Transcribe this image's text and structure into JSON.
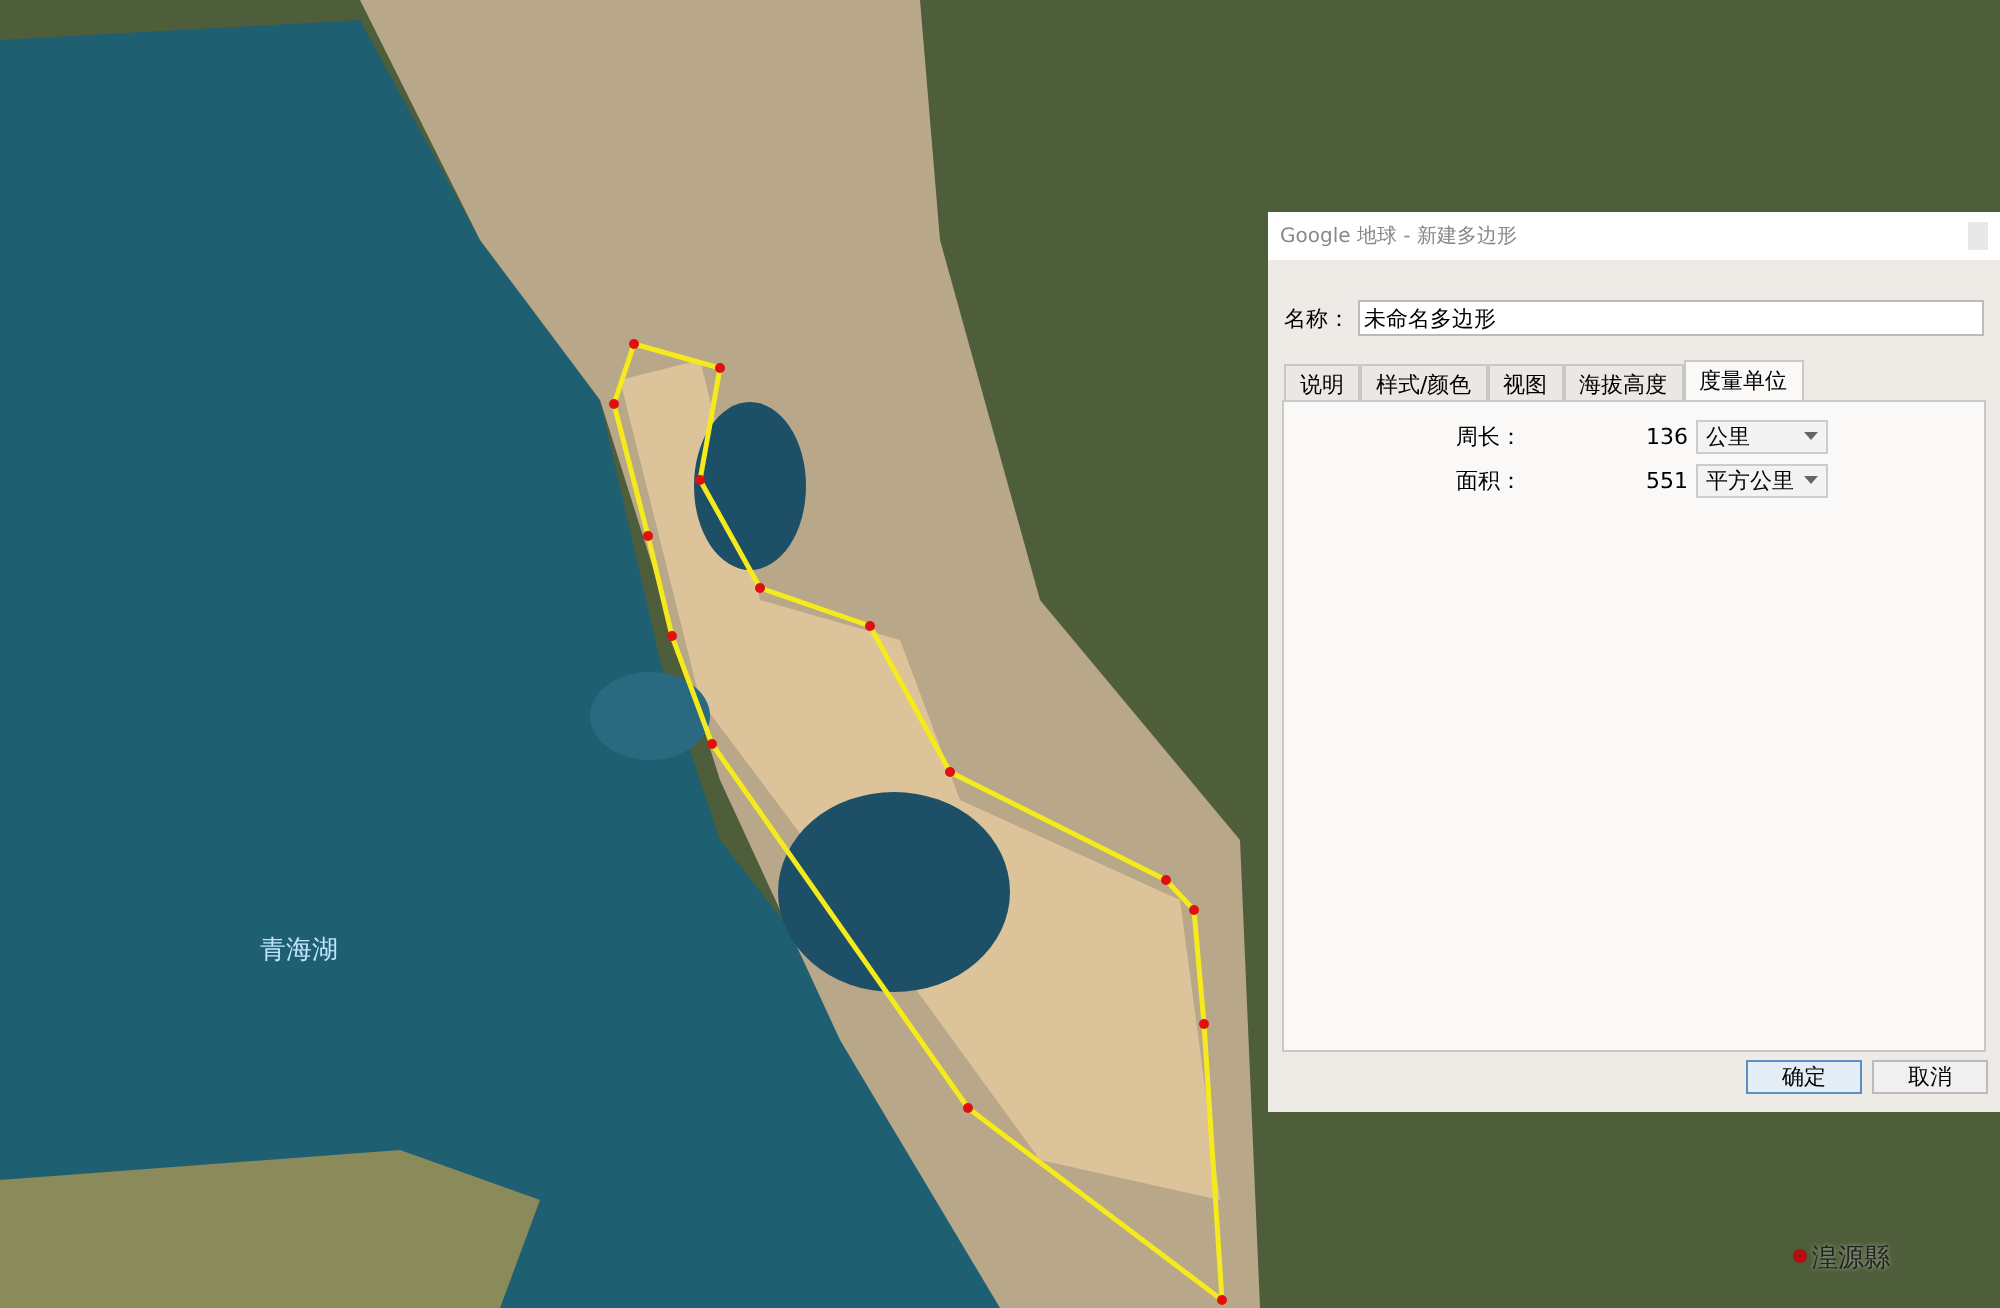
{
  "map": {
    "labels": [
      {
        "kind": "lake",
        "text": "青海湖"
      },
      {
        "kind": "town",
        "text": "湟源縣"
      }
    ]
  },
  "dialog": {
    "title": "Google 地球 - 新建多边形",
    "name_label": "名称：",
    "name_value": "未命名多边形",
    "tabs": [
      {
        "label": "说明",
        "selected": false
      },
      {
        "label": "样式/颜色",
        "selected": false
      },
      {
        "label": "视图",
        "selected": false
      },
      {
        "label": "海拔高度",
        "selected": false
      },
      {
        "label": "度量单位",
        "selected": true
      }
    ],
    "measurements": [
      {
        "label": "周长：",
        "value": "136",
        "unit": "公里"
      },
      {
        "label": "面积：",
        "value": "551",
        "unit": "平方公里"
      }
    ],
    "buttons": [
      {
        "label": "确定",
        "default": true
      },
      {
        "label": "取消",
        "default": false
      }
    ]
  }
}
